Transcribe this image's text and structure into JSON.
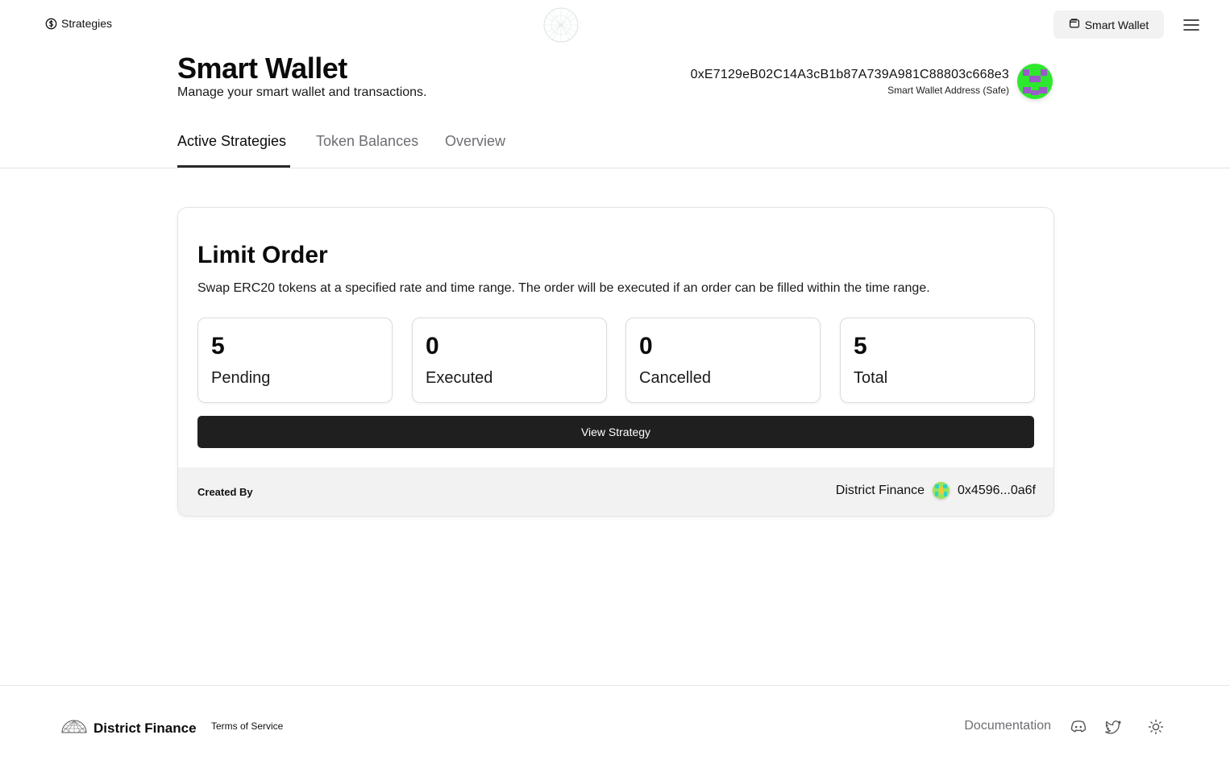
{
  "nav": {
    "strategies_label": "Strategies",
    "strategies_icon": "dollar-circle-icon",
    "wallet_button_label": "Smart Wallet",
    "wallet_button_icon": "wallet-icon",
    "menu_icon": "hamburger-menu-icon",
    "center_logo_icon": "geodesic-sphere-logo"
  },
  "header": {
    "title": "Smart Wallet",
    "subtitle": "Manage your smart wallet and transactions.",
    "wallet_address": "0xE7129eB02C14A3cB1b87A739A981C88803c668e3",
    "wallet_address_label": "Smart Wallet Address (Safe)"
  },
  "tabs": [
    {
      "label": "Active Strategies",
      "active": true
    },
    {
      "label": "Token Balances",
      "active": false
    },
    {
      "label": "Overview",
      "active": false
    }
  ],
  "strategy_card": {
    "title": "Limit Order",
    "description": "Swap ERC20 tokens at a specified rate and time range. The order will be executed if an order can be filled within the time range.",
    "stats": [
      {
        "value": "5",
        "label": "Pending"
      },
      {
        "value": "0",
        "label": "Executed"
      },
      {
        "value": "0",
        "label": "Cancelled"
      },
      {
        "value": "5",
        "label": "Total"
      }
    ],
    "view_button_label": "View Strategy",
    "created_by_label": "Created By",
    "creator_name": "District Finance",
    "creator_address": "0x4596...0a6f"
  },
  "footer": {
    "brand_name": "District Finance",
    "terms_label": "Terms of Service",
    "docs_label": "Documentation",
    "icons": [
      "discord-icon",
      "twitter-icon",
      "sun-icon"
    ]
  },
  "colors": {
    "primary_button": "#1f1f1f",
    "muted_text": "#6e6e73",
    "surface_gray": "#f2f2f2",
    "avatar_green": "#2ee82e",
    "avatar_purple": "#9b59c9"
  }
}
